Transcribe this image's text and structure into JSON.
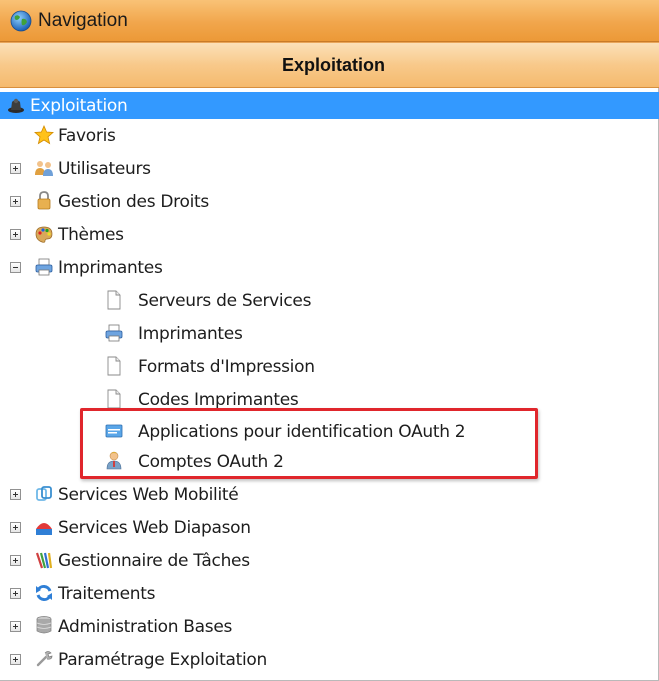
{
  "window": {
    "title": "Navigation",
    "title_icon": "globe-icon"
  },
  "section": {
    "title": "Exploitation"
  },
  "tree": {
    "root": {
      "label": "Exploitation",
      "icon": "exploitation-icon",
      "selected": true
    },
    "items": [
      {
        "label": "Favoris",
        "icon": "star-icon",
        "expander": "none"
      },
      {
        "label": "Utilisateurs",
        "icon": "users-icon",
        "expander": "plus"
      },
      {
        "label": "Gestion des Droits",
        "icon": "lock-icon",
        "expander": "plus"
      },
      {
        "label": "Thèmes",
        "icon": "palette-icon",
        "expander": "plus"
      },
      {
        "label": "Imprimantes",
        "icon": "printer-icon",
        "expander": "minus",
        "children": [
          {
            "label": "Serveurs de Services",
            "icon": "document-icon"
          },
          {
            "label": "Imprimantes",
            "icon": "printer-icon"
          },
          {
            "label": "Formats d'Impression",
            "icon": "document-icon"
          },
          {
            "label": "Codes Imprimantes",
            "icon": "document-icon"
          },
          {
            "label": "Applications pour identification OAuth 2",
            "icon": "application-window-icon"
          },
          {
            "label": "Comptes OAuth 2",
            "icon": "user-account-icon"
          }
        ]
      },
      {
        "label": "Services Web Mobilité",
        "icon": "mobile-services-icon",
        "expander": "plus"
      },
      {
        "label": "Services Web Diapason",
        "icon": "diapason-services-icon",
        "expander": "plus"
      },
      {
        "label": "Gestionnaire de Tâches",
        "icon": "task-manager-icon",
        "expander": "plus"
      },
      {
        "label": "Traitements",
        "icon": "refresh-icon",
        "expander": "plus"
      },
      {
        "label": "Administration  Bases",
        "icon": "database-icon",
        "expander": "plus"
      },
      {
        "label": "Paramétrage Exploitation",
        "icon": "wrench-icon",
        "expander": "plus"
      }
    ]
  },
  "colors": {
    "selection": "#3399ff",
    "highlight_border": "#e0262c",
    "titlebar": "#f1a64c"
  }
}
